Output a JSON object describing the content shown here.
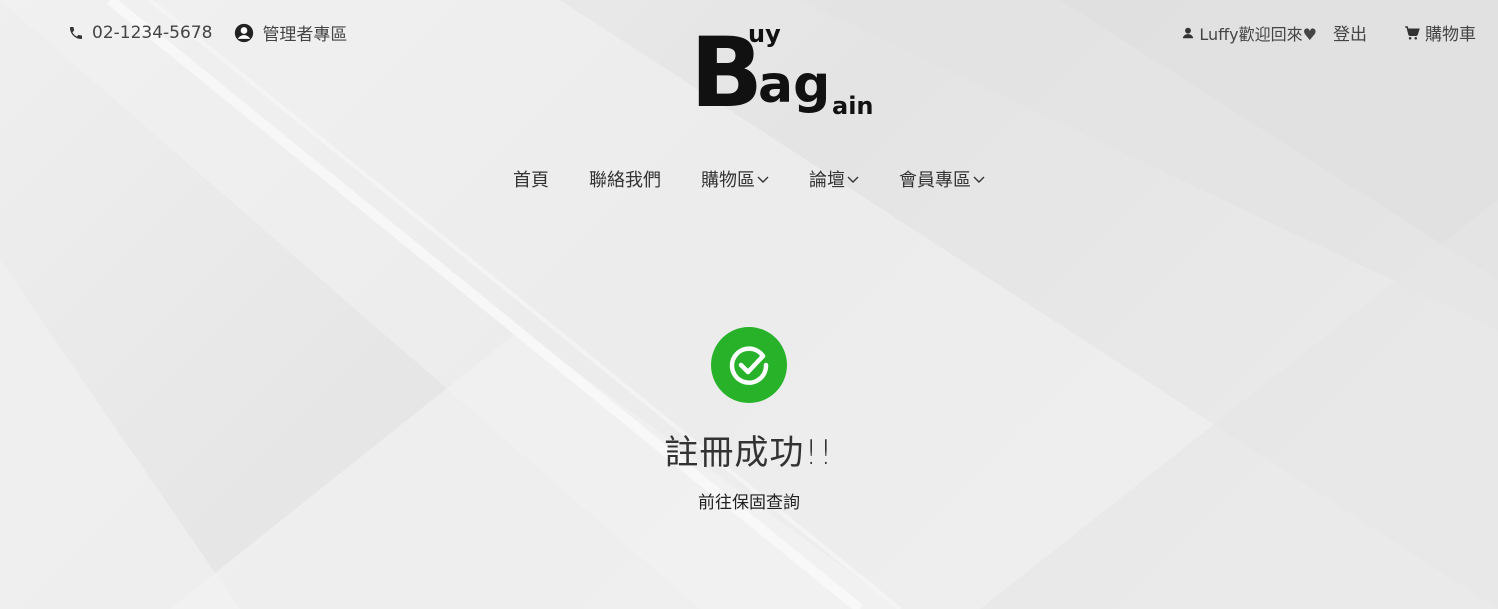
{
  "topbar": {
    "phone": "02-1234-5678",
    "admin_label": "管理者專區",
    "welcome": "Luffy歡迎回來♥",
    "logout_label": "登出",
    "cart_label": "購物車"
  },
  "logo": {
    "big_b": "B",
    "uy": "uy",
    "ag": "ag",
    "ain": "ain"
  },
  "nav": {
    "items": [
      {
        "label": "首頁",
        "dropdown": false
      },
      {
        "label": "聯絡我們",
        "dropdown": false
      },
      {
        "label": "購物區",
        "dropdown": true
      },
      {
        "label": "論壇",
        "dropdown": true
      },
      {
        "label": "會員專區",
        "dropdown": true
      }
    ]
  },
  "result": {
    "title": "註冊成功!!",
    "link": "前往保固查詢",
    "icon": "check-circle-icon",
    "color": "#27b22a"
  }
}
